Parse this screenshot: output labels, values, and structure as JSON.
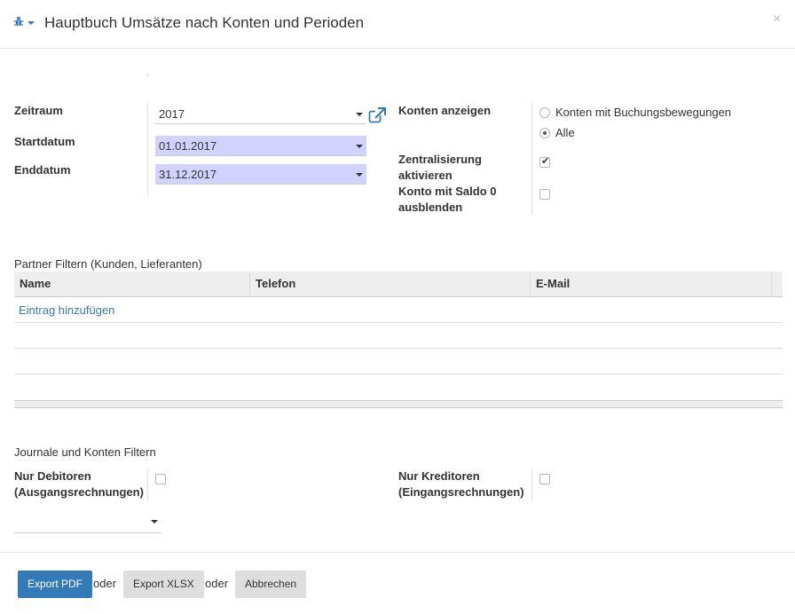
{
  "header": {
    "title": "Hauptbuch Umsätze nach Konten und Perioden",
    "close_glyph": "×"
  },
  "form": {
    "zeitraum": {
      "label": "Zeitraum",
      "value": "2017"
    },
    "startdatum": {
      "label": "Startdatum",
      "value": "01.01.2017"
    },
    "enddatum": {
      "label": "Enddatum",
      "value": "31.12.2017"
    },
    "konten_anzeigen": {
      "label": "Konten anzeigen",
      "options": [
        "Konten mit Buchungsbewegungen",
        "Alle"
      ],
      "selected": "Alle"
    },
    "zentralisierung": {
      "label_line1": "Zentralisierung",
      "label_line2": "aktivieren",
      "checked": true
    },
    "saldo_null": {
      "label_line1": "Konto mit Saldo 0",
      "label_line2": "ausblenden",
      "checked": false
    }
  },
  "partner": {
    "section_title": "Partner Filtern (Kunden, Lieferanten)",
    "columns": [
      "Name",
      "Telefon",
      "E-Mail"
    ],
    "add_entry": "Eintrag hinzufügen"
  },
  "journale": {
    "section_title": "Journale und Konten Filtern",
    "nur_debitoren": {
      "label_line1": "Nur Debitoren",
      "label_line2": "(Ausgangsrechnungen)",
      "checked": false
    },
    "nur_kreditoren": {
      "label_line1": "Nur Kreditoren",
      "label_line2": "(Eingangsrechnungen)",
      "checked": false
    },
    "journal_select": {
      "value": ""
    }
  },
  "footer": {
    "export_pdf": "Export PDF",
    "or1": "oder",
    "export_xlsx": "Export XLSX",
    "or2": "oder",
    "cancel": "Abbrechen"
  },
  "colors": {
    "primary": "#337ab7",
    "required_field": "#d2d2ff",
    "table_header": "#eeeeee"
  }
}
